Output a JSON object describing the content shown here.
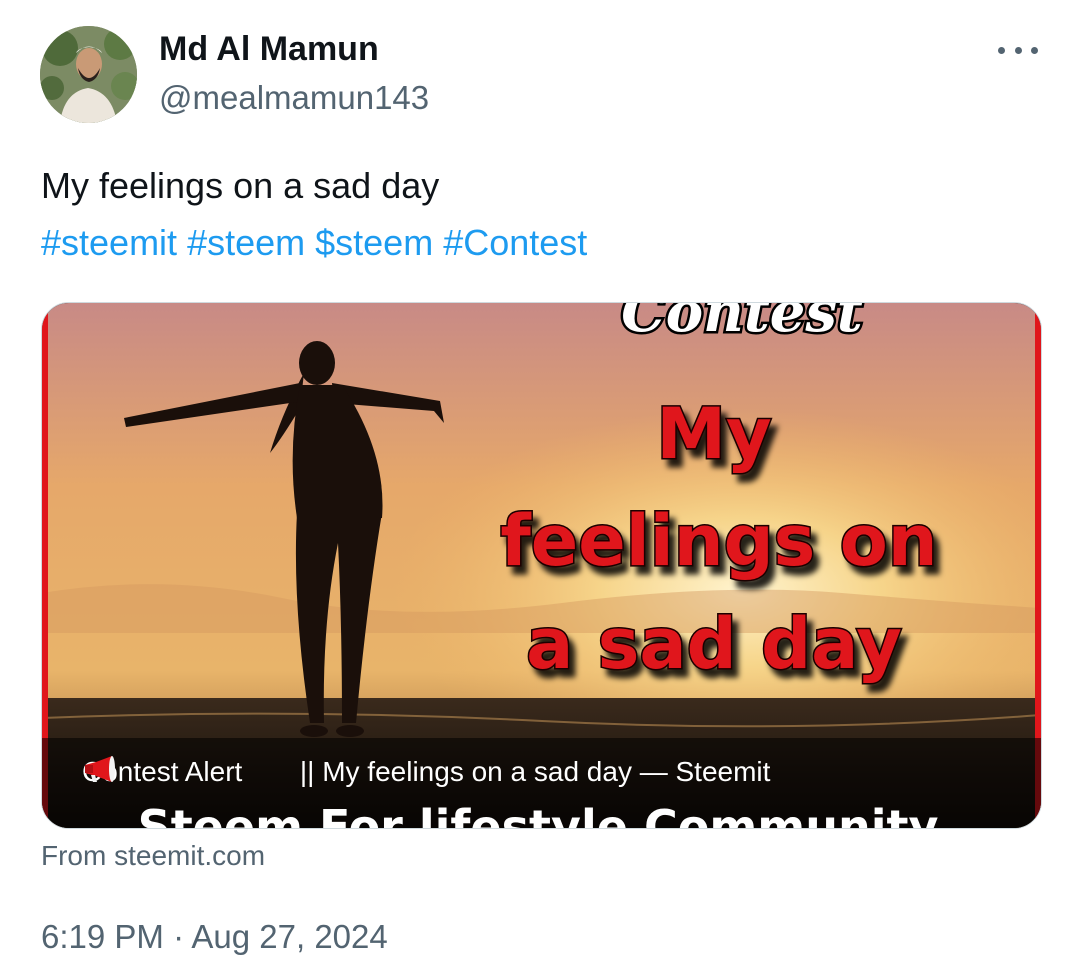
{
  "author": {
    "display_name": "Md Al Mamun",
    "handle": "@mealmamun143"
  },
  "tweet": {
    "text": "My feelings on a sad day",
    "hashtags": [
      "#steemit",
      "#steem",
      "$steem",
      "#Contest"
    ],
    "link_color": "#1d9bf0"
  },
  "card": {
    "image_text_top": "Contest",
    "image_title_lines": [
      "My",
      "feelings on",
      "a sad day"
    ],
    "image_text_bottom": "Steem For lifestyle Community",
    "caption_before_icon": "Contest Alert",
    "caption_icon": "megaphone-icon",
    "caption_after_icon": "|| My feelings on a sad day — Steemit",
    "source": "From steemit.com",
    "title_color": "#e0161b"
  },
  "meta": {
    "timestamp": "6:19 PM · Aug 27, 2024"
  },
  "icons": {
    "more": "more-horizontal-icon"
  }
}
